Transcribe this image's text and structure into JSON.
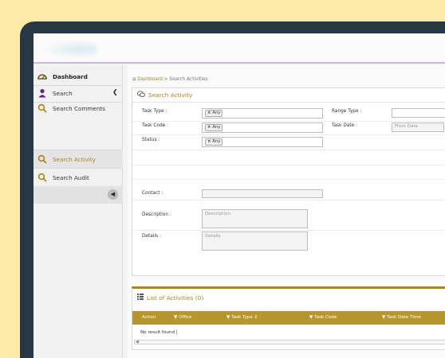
{
  "sidebar": {
    "items": [
      {
        "label": "Dashboard",
        "icon": "dashboard-icon"
      },
      {
        "label": "Search",
        "icon": "user-icon"
      },
      {
        "label": "Search Comments",
        "icon": "search-icon"
      },
      {
        "label": "Search Activity",
        "icon": "search-icon"
      },
      {
        "label": "Search Audit",
        "icon": "search-icon"
      }
    ],
    "collapse_arrow": "◀",
    "search_chevron": "❮"
  },
  "breadcrumb": {
    "home": "Dashboard",
    "separator": ">",
    "current": "Search Activities"
  },
  "search_panel": {
    "title": "Search Activity",
    "task_type_label": "Task Type :",
    "task_type_chip": "Any",
    "range_type_label": "Range Type :",
    "task_code_label": "Task Code :",
    "task_code_chip": "Any",
    "task_date_label": "Task Date :",
    "from_date_placeholder": "From Date",
    "status_label": "Status :",
    "status_chip": "Any",
    "contact_label": "Contact :",
    "description_label": "Description :",
    "description_placeholder": "Description",
    "details_label": "Details :",
    "details_placeholder": "Details",
    "chip_remove": "×"
  },
  "list_panel": {
    "title": "List of Activities (0)",
    "columns": [
      {
        "label": "Action"
      },
      {
        "label": "Office"
      },
      {
        "label": "Task Type"
      },
      {
        "label": "Task Code"
      },
      {
        "label": "Task Date Time"
      }
    ],
    "no_result": "No result found |"
  },
  "colors": {
    "accent": "#a48721",
    "table_header": "#b8962e",
    "frame": "#263845",
    "background": "#fde9a8"
  }
}
